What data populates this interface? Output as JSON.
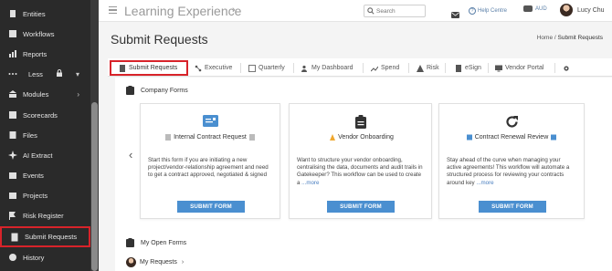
{
  "sidebar": {
    "items": [
      {
        "label": "Entities",
        "icon": "building-icon"
      },
      {
        "label": "Workflows",
        "icon": "workflow-icon"
      },
      {
        "label": "Reports",
        "icon": "reports-icon"
      },
      {
        "label": "Less",
        "icon": "dots-icon"
      },
      {
        "label": "Modules",
        "icon": "modules-icon"
      },
      {
        "label": "Scorecards",
        "icon": "scorecard-icon"
      },
      {
        "label": "Files",
        "icon": "folder-icon"
      },
      {
        "label": "AI Extract",
        "icon": "sparkle-icon"
      },
      {
        "label": "Events",
        "icon": "event-icon"
      },
      {
        "label": "Projects",
        "icon": "project-icon"
      },
      {
        "label": "Risk Register",
        "icon": "risk-icon"
      },
      {
        "label": "Submit Requests",
        "icon": "submit-icon"
      },
      {
        "label": "History",
        "icon": "history-icon"
      }
    ]
  },
  "header": {
    "app_title": "Learning Experience",
    "search_placeholder": "Search",
    "help_label": "Help Centre",
    "currency": "AUD",
    "user_name": "Lucy Chu"
  },
  "page": {
    "title": "Submit Requests",
    "breadcrumb_home": "Home",
    "breadcrumb_sep": "/",
    "breadcrumb_current": "Submit Requests"
  },
  "tabs": [
    {
      "label": "Submit Requests"
    },
    {
      "label": "Executive"
    },
    {
      "label": "Quarterly"
    },
    {
      "label": "My Dashboard"
    },
    {
      "label": "Spend"
    },
    {
      "label": "Risk"
    },
    {
      "label": "eSign"
    },
    {
      "label": "Vendor Portal"
    }
  ],
  "company_forms": {
    "heading": "Company Forms",
    "cards": [
      {
        "title": "Internal Contract Request",
        "description": "Start this form if you are initiating a new project/vendor-relationship agreement and need to get a contract approved, negotiated & signed",
        "more": "",
        "button": "SUBMIT FORM"
      },
      {
        "title": "Vendor Onboarding",
        "description": "Want to structure your vendor onboarding, centralising the data, documents and audit trails in Gatekeeper? This workflow can be used to create a ",
        "more": "...more",
        "button": "SUBMIT FORM"
      },
      {
        "title": "Contract Renewal Review",
        "description": "Stay ahead of the curve when managing your active agreements! This workflow will automate a structured process for reviewing your contracts around key ",
        "more": "...more",
        "button": "SUBMIT FORM"
      }
    ]
  },
  "open_forms": {
    "heading": "My Open Forms",
    "my_requests": "My Requests"
  },
  "colors": {
    "sidebar_bg": "#2a2a2a",
    "highlight": "#d8232a",
    "button": "#4a8fd0",
    "link": "#4a7fc0"
  }
}
